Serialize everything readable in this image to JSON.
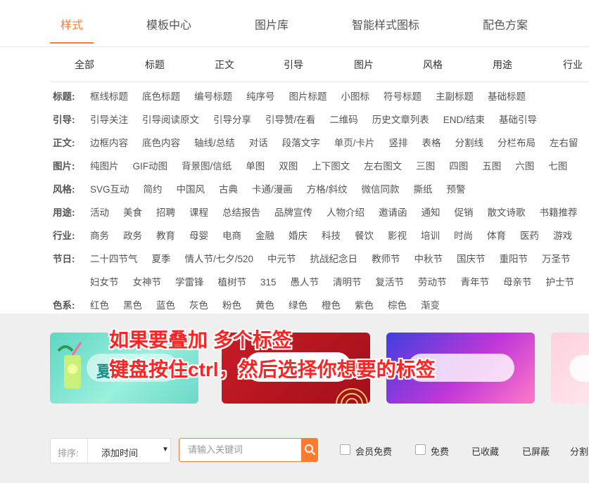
{
  "top_tabs": [
    "样式",
    "模板中心",
    "图片库",
    "智能样式图标",
    "配色方案"
  ],
  "sub_tabs": [
    "全部",
    "标题",
    "正文",
    "引导",
    "图片",
    "风格",
    "用途",
    "行业"
  ],
  "rows": [
    {
      "label": "标题:",
      "items": [
        "框线标题",
        "底色标题",
        "编号标题",
        "纯序号",
        "图片标题",
        "小图标",
        "符号标题",
        "主副标题",
        "基础标题"
      ]
    },
    {
      "label": "引导:",
      "items": [
        "引导关注",
        "引导阅读原文",
        "引导分享",
        "引导赞/在看",
        "二维码",
        "历史文章列表",
        "END/结束",
        "基础引导"
      ]
    },
    {
      "label": "正文:",
      "items": [
        "边框内容",
        "底色内容",
        "轴线/总结",
        "对话",
        "段落文字",
        "单页/卡片",
        "竖排",
        "表格",
        "分割线",
        "分栏布局",
        "左右留"
      ]
    },
    {
      "label": "图片:",
      "items": [
        "纯图片",
        "GIF动图",
        "背景图/信纸",
        "单图",
        "双图",
        "上下图文",
        "左右图文",
        "三图",
        "四图",
        "五图",
        "六图",
        "七图"
      ]
    },
    {
      "label": "风格:",
      "items": [
        "SVG互动",
        "简约",
        "中国风",
        "古典",
        "卡通/漫画",
        "方格/斜纹",
        "微信同款",
        "撕纸",
        "预警"
      ]
    },
    {
      "label": "用途:",
      "items": [
        "活动",
        "美食",
        "招聘",
        "课程",
        "总结报告",
        "品牌宣传",
        "人物介绍",
        "邀请函",
        "通知",
        "促销",
        "散文诗歌",
        "书籍推荐"
      ]
    },
    {
      "label": "行业:",
      "items": [
        "商务",
        "政务",
        "教育",
        "母婴",
        "电商",
        "金融",
        "婚庆",
        "科技",
        "餐饮",
        "影视",
        "培训",
        "时尚",
        "体育",
        "医药",
        "游戏"
      ]
    },
    {
      "label": "节日:",
      "items": [
        "二十四节气",
        "夏季",
        "情人节/七夕/520",
        "中元节",
        "抗战纪念日",
        "教师节",
        "中秋节",
        "国庆节",
        "重阳节",
        "万圣节"
      ]
    },
    {
      "label": "",
      "items": [
        "妇女节",
        "女神节",
        "学雷锋",
        "植树节",
        "315",
        "愚人节",
        "清明节",
        "复活节",
        "劳动节",
        "青年节",
        "母亲节",
        "护士节"
      ]
    },
    {
      "label": "色系:",
      "items": [
        "红色",
        "黑色",
        "蓝色",
        "灰色",
        "粉色",
        "黄色",
        "绿色",
        "橙色",
        "紫色",
        "棕色",
        "渐变"
      ]
    }
  ],
  "banner1_text": "夏",
  "overlay": {
    "line1": "如果要叠加 多个标签",
    "line2": "键盘按住ctrl，然后选择你想要的标签"
  },
  "filter": {
    "sort_label": "排序:",
    "sort_value": "添加时间",
    "search_placeholder": "请输入关键词",
    "members_free": "会员免费",
    "free": "免费",
    "collected": "已收藏",
    "blocked": "已屏蔽",
    "more": "分割线"
  },
  "colors": {
    "accent": "#ff7a2f",
    "overlay_text": "#ff2323"
  }
}
